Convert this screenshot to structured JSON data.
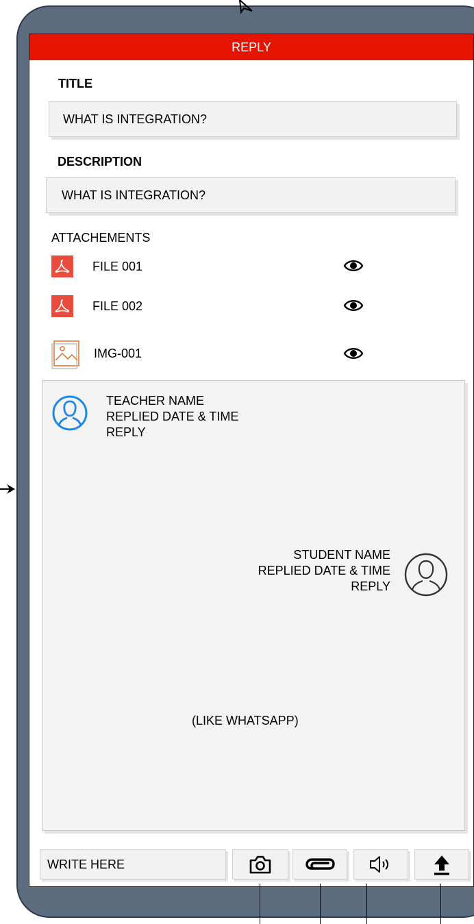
{
  "header": {
    "title": "REPLY"
  },
  "form": {
    "title_label": "TITLE",
    "title_value": "WHAT IS INTEGRATION?",
    "description_label": "DESCRIPTION",
    "description_value": "WHAT IS INTEGRATION?"
  },
  "attachments": {
    "label": "ATTACHEMENTS",
    "items": [
      {
        "name": "FILE 001",
        "icon": "pdf-icon",
        "action_icon": "eye-icon"
      },
      {
        "name": "FILE 002",
        "icon": "pdf-icon",
        "action_icon": "eye-icon"
      },
      {
        "name": "IMG-001",
        "icon": "image-icon",
        "action_icon": "eye-icon"
      }
    ]
  },
  "chat": {
    "teacher": {
      "name": "TEACHER NAME",
      "datetime": "REPLIED DATE & TIME",
      "text": "REPLY",
      "icon": "user-avatar-icon"
    },
    "student": {
      "name": "STUDENT NAME",
      "datetime": "REPLIED DATE & TIME",
      "text": "REPLY",
      "icon": "user-avatar-icon"
    },
    "note": "(LIKE WHATSAPP)"
  },
  "composer": {
    "placeholder": "WRITE HERE",
    "buttons": [
      {
        "icon": "camera-icon"
      },
      {
        "icon": "paperclip-icon"
      },
      {
        "icon": "speaker-icon"
      },
      {
        "icon": "upload-icon"
      }
    ]
  },
  "colors": {
    "header": "#e51400",
    "device_frame": "#5d6d80",
    "pdf_icon": "#e84c3d",
    "avatar_blue": "#1e88e5",
    "image_icon": "#e07b39"
  }
}
